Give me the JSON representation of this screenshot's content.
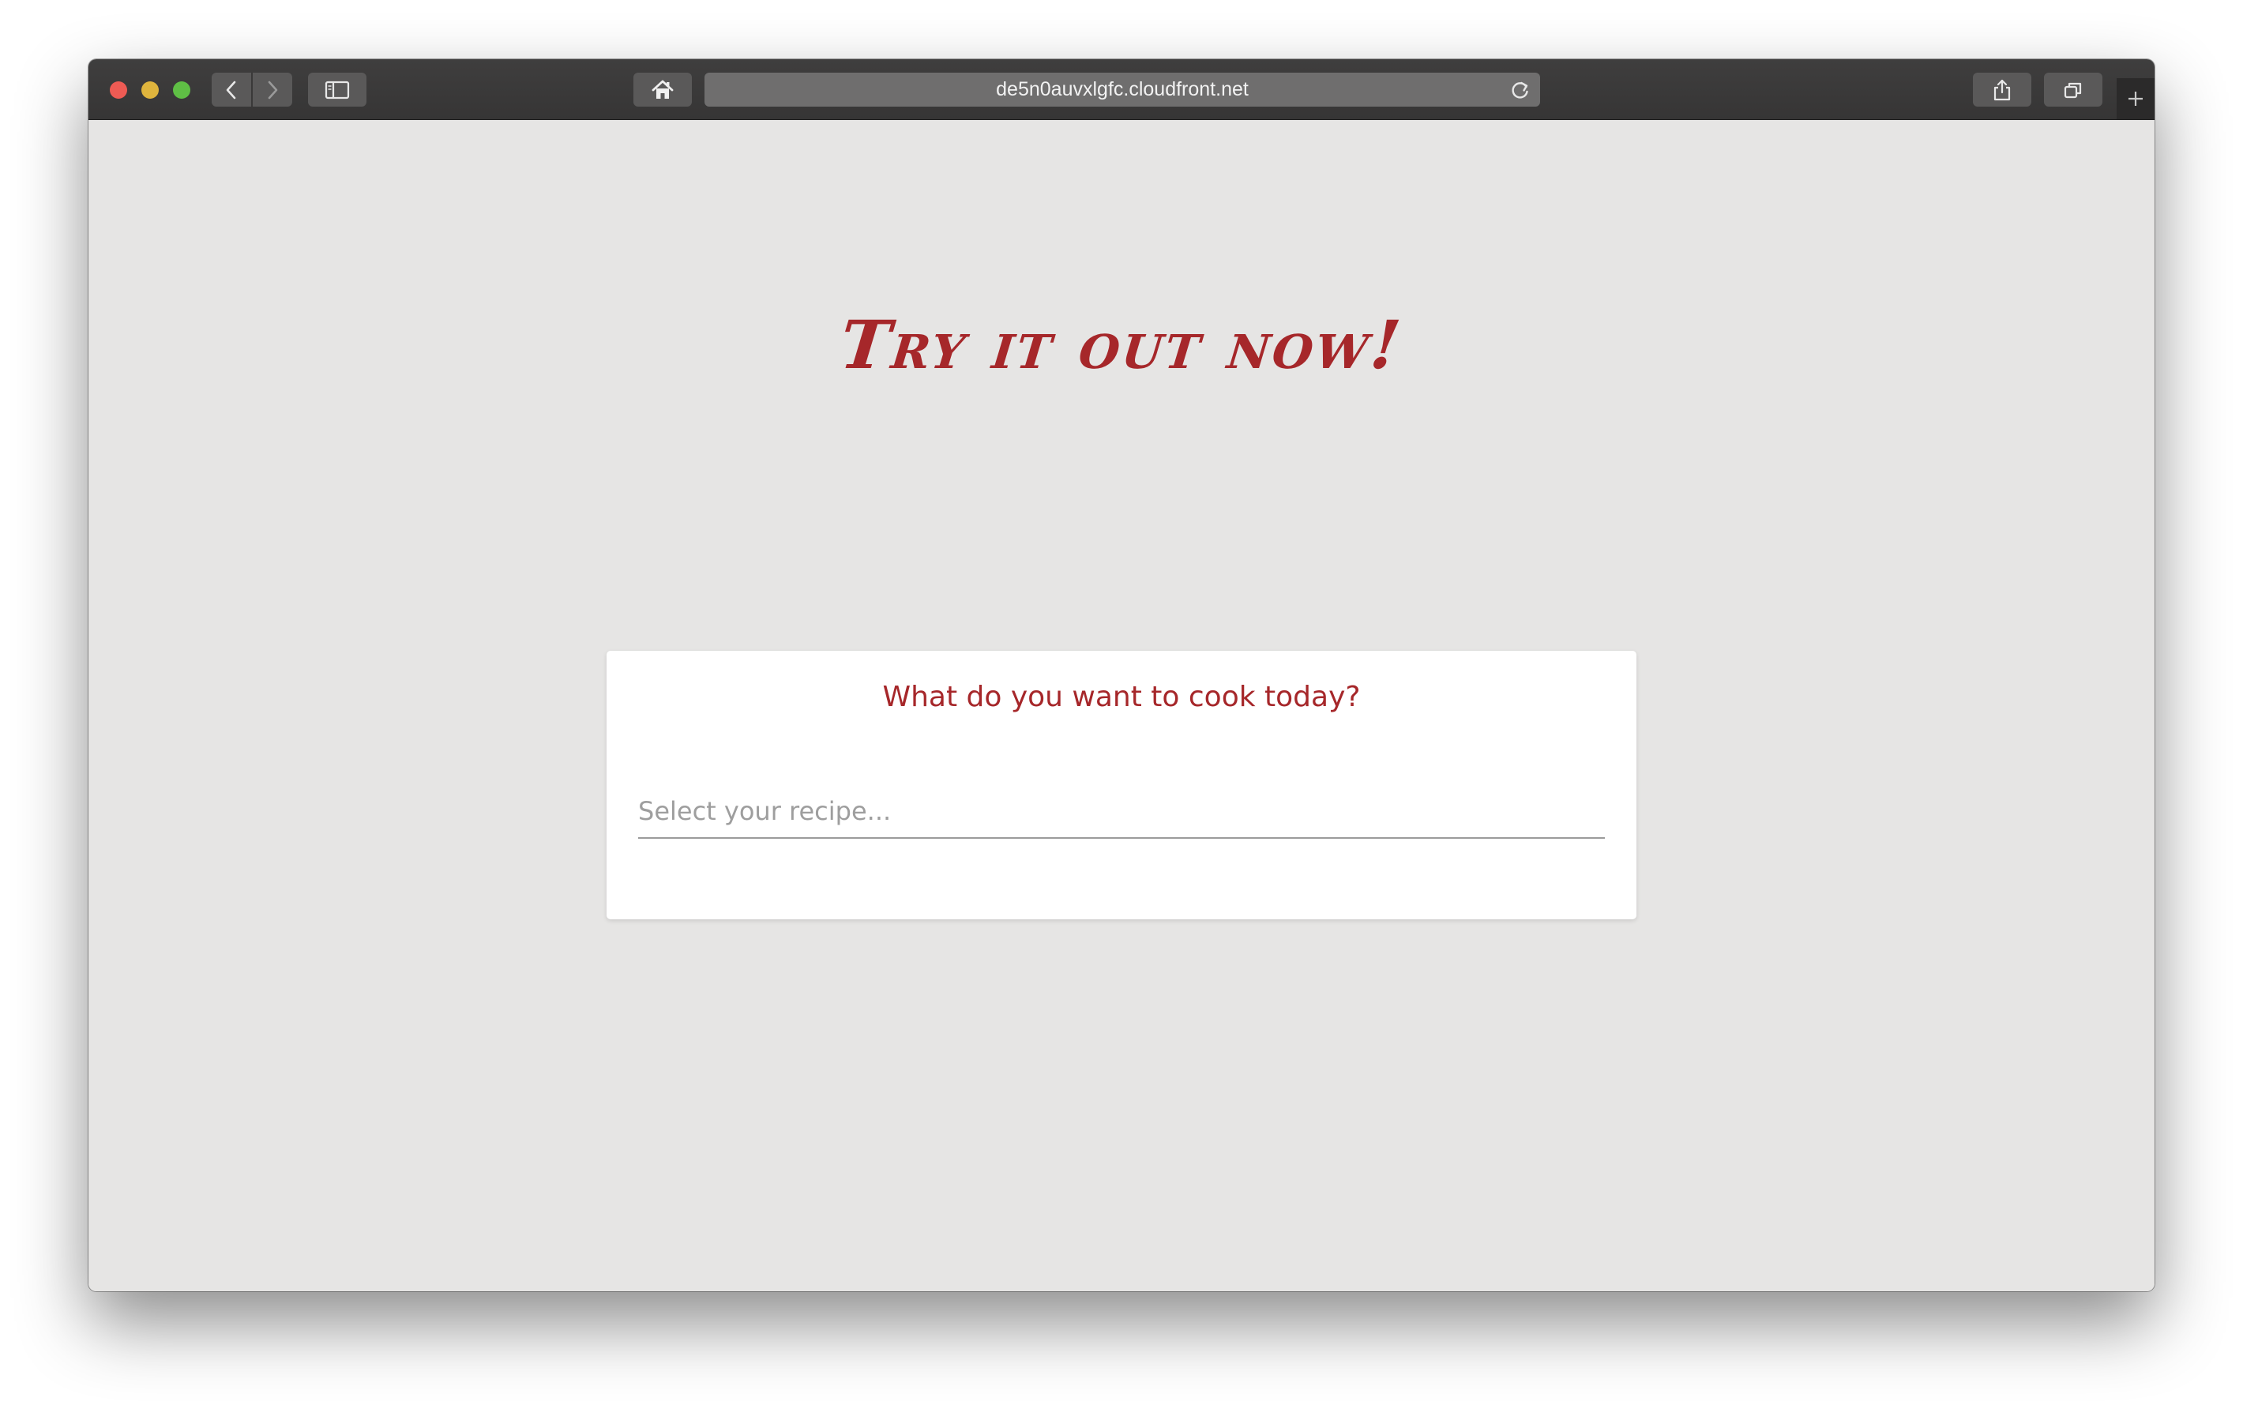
{
  "browser": {
    "url": "de5n0auvxlgfc.cloudfront.net",
    "icons": {
      "close": "close-dot",
      "minimize": "minimize-dot",
      "maximize": "maximize-dot",
      "back": "chevron-left-icon",
      "forward": "chevron-right-icon",
      "sidebar": "sidebar-icon",
      "home": "home-icon",
      "reload": "reload-icon",
      "share": "share-icon",
      "tabs": "tabs-icon",
      "new_tab": "plus-icon"
    },
    "colors": {
      "chrome": "#3f3e3e",
      "close": "#ee5b54",
      "minimize": "#dfb43d",
      "maximize": "#5fbf45"
    }
  },
  "page": {
    "heading": "Try it out now!",
    "card": {
      "title": "What do you want to cook today?",
      "input_value": "",
      "input_placeholder": "Select your recipe..."
    },
    "colors": {
      "background": "#e6e5e4",
      "accent": "#a6272a",
      "card": "#ffffff"
    }
  }
}
